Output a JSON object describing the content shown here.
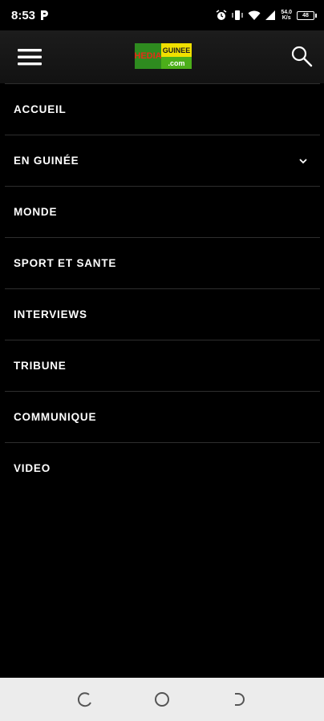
{
  "status_bar": {
    "time": "8:53",
    "net_speed_value": "54.0",
    "net_speed_unit": "K/s",
    "battery": "48"
  },
  "header": {
    "logo_left": "HEDIA",
    "logo_top": "GUINEE",
    "logo_bottom": ".com",
    "colors": {
      "logo_green": "#2e8b1f",
      "logo_yellow": "#f0e000",
      "logo_red": "#e52d16"
    }
  },
  "menu": {
    "items": [
      {
        "label": "ACCUEIL"
      },
      {
        "label": "EN GUINÉE",
        "has_submenu": true
      },
      {
        "label": "MONDE"
      },
      {
        "label": "SPORT ET SANTE"
      },
      {
        "label": "INTERVIEWS"
      },
      {
        "label": "TRIBUNE"
      },
      {
        "label": "COMMUNIQUE"
      },
      {
        "label": "VIDEO"
      }
    ]
  },
  "icons": [
    "menu-icon",
    "search-icon",
    "chevron-down-icon",
    "alarm-icon",
    "wifi-icon",
    "signal-icon",
    "battery-icon",
    "recents-icon",
    "home-icon",
    "back-icon"
  ]
}
